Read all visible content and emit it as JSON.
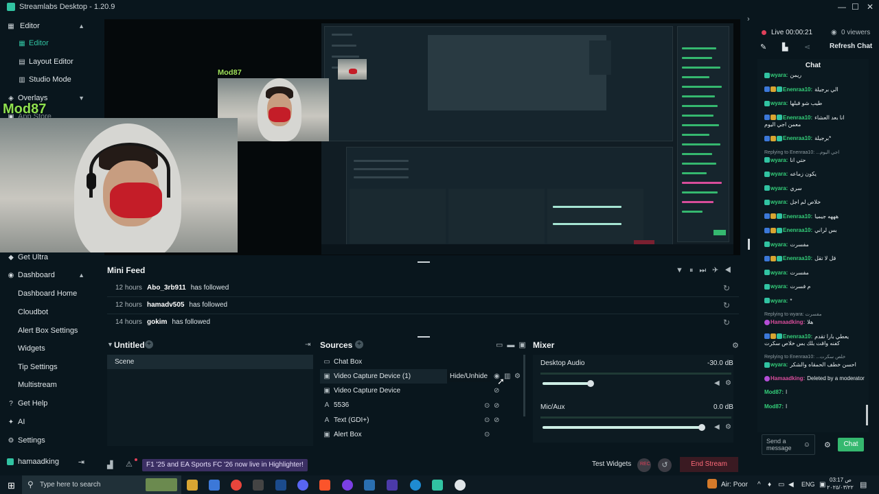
{
  "app": {
    "title": "Streamlabs Desktop - 1.20.9"
  },
  "sidebar": {
    "items": [
      {
        "label": "Editor",
        "icon": "grid-icon",
        "top": true
      },
      {
        "label": "Editor",
        "icon": "grid-icon"
      },
      {
        "label": "Layout Editor",
        "icon": "layout-icon"
      },
      {
        "label": "Studio Mode",
        "icon": "studio-icon"
      },
      {
        "label": "Overlays",
        "icon": "overlay-icon"
      },
      {
        "label": "App Store",
        "icon": "store-icon"
      },
      {
        "label": "Get Ultra",
        "icon": "ultra-icon"
      },
      {
        "label": "Dashboard",
        "icon": "dashboard-icon"
      },
      {
        "label": "Dashboard Home"
      },
      {
        "label": "Cloudbot"
      },
      {
        "label": "Alert Box Settings"
      },
      {
        "label": "Widgets"
      },
      {
        "label": "Tip Settings"
      },
      {
        "label": "Multistream"
      },
      {
        "label": "Get Help",
        "icon": "help-icon"
      },
      {
        "label": "AI",
        "icon": "ai-icon"
      },
      {
        "label": "Settings",
        "icon": "gear-icon"
      }
    ],
    "user": "hamaadking"
  },
  "preview": {
    "overlay_name": "Mod87",
    "inner_overlay_name": "Mod87"
  },
  "mini_feed": {
    "title": "Mini Feed",
    "rows": [
      {
        "time": "12 hours",
        "name": "Abo_3rb911",
        "action": "has followed"
      },
      {
        "time": "12 hours",
        "name": "hamadv505",
        "action": "has followed"
      },
      {
        "time": "14 hours",
        "name": "gokim",
        "action": "has followed"
      }
    ]
  },
  "scenes": {
    "title": "Untitled",
    "items": [
      "Scene"
    ]
  },
  "sources": {
    "title": "Sources",
    "items": [
      {
        "label": "Chat Box",
        "icon": "chat-icon"
      },
      {
        "label": "Video Capture Device (1)",
        "icon": "camera-icon"
      },
      {
        "label": "Video Capture Device",
        "icon": "camera-icon"
      },
      {
        "label": "5536",
        "icon": "text-icon"
      },
      {
        "label": "Text (GDI+)",
        "icon": "text-icon"
      },
      {
        "label": "Alert Box",
        "icon": "camera-icon"
      }
    ],
    "tooltip": "Hide/Unhide"
  },
  "mixer": {
    "title": "Mixer",
    "channels": [
      {
        "name": "Desktop Audio",
        "db": "-30.0 dB",
        "level": 0.3
      },
      {
        "name": "Mic/Aux",
        "db": "0.0 dB",
        "level": 1.0
      }
    ]
  },
  "bottom": {
    "notice": "F1 '25 and EA Sports FC '26 now live in Highlighter!",
    "test_widgets": "Test Widgets",
    "end_stream": "End Stream"
  },
  "live": {
    "status": "Live 00:00:21",
    "viewers": "0 viewers",
    "refresh": "Refresh Chat"
  },
  "chat": {
    "title": "Chat",
    "messages": [
      {
        "user": "wyara:",
        "text": "ريمن"
      },
      {
        "user": "Enenraa10:",
        "text": "الي برجيلة",
        "badges": true
      },
      {
        "user": "wyara:",
        "text": "طيب شو قبلها"
      },
      {
        "user": "Enenraa10:",
        "text": "انا بعد العشاء",
        "badges": true,
        "extra": "معمن اجي اليوم"
      },
      {
        "user": "Enenraa10:",
        "text": "برجيلة*",
        "badges": true
      },
      {
        "user": "wyara:",
        "text": "حتي انا",
        "reply": "Replying to Enenraa10: ...اجي اليوم"
      },
      {
        "user": "wyara:",
        "text": "يكون زماعه"
      },
      {
        "user": "wyara:",
        "text": "سري"
      },
      {
        "user": "wyara:",
        "text": "خلاص لم اجل"
      },
      {
        "user": "Enenraa10:",
        "text": "هههه جيميا",
        "badges": true
      },
      {
        "user": "Enenraa10:",
        "text": "بس لراني",
        "badges": true
      },
      {
        "user": "wyara:",
        "text": "مفسرت"
      },
      {
        "user": "Enenraa10:",
        "text": "قل لا تقل",
        "badges": true
      },
      {
        "user": "wyara:",
        "text": "مفسرت"
      },
      {
        "user": "wyara:",
        "text": "م فسرت"
      },
      {
        "user": "wyara:",
        "text": "*"
      },
      {
        "user": "Hamaadking:",
        "text": "هلا",
        "reply": "Replying to wyara: مفسرت"
      },
      {
        "user": "Enenraa10:",
        "text": "يعطي بارا تقدم",
        "badges": true,
        "extra": "كفنه واقت بلك بس خلاص سكرت"
      },
      {
        "user": "wyara:",
        "text": "احسن خطف الحمقاه والشكر",
        "reply": "Replying to Enenraa10: ...خلص سكرت"
      },
      {
        "user": "Hamaadking:",
        "text": "Deleted by a moderator"
      },
      {
        "user": "Mod87:",
        "text": "ا"
      },
      {
        "user": "Mod87:",
        "text": "ا"
      }
    ],
    "input_placeholder": "Send a message",
    "send_label": "Chat"
  },
  "taskbar": {
    "search": "Type here to search",
    "air": "Air: Poor",
    "lang": "ENG",
    "time": "03:17 ص",
    "date": "٢٠٢٥/٠٣/٢٢"
  }
}
